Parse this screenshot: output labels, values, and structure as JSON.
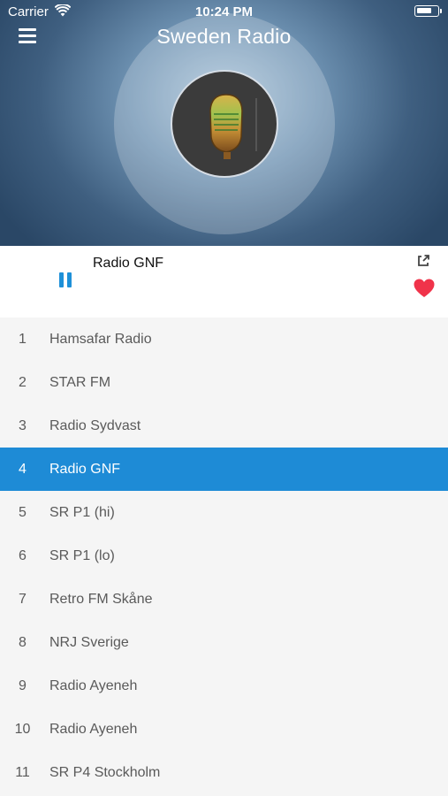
{
  "status_bar": {
    "carrier": "Carrier",
    "time": "10:24 PM"
  },
  "header": {
    "title": "Sweden Radio",
    "menu_icon": "hamburger-menu-icon"
  },
  "player": {
    "now_playing": "Radio GNF",
    "state_icon": "pause-icon",
    "share_icon": "external-link-icon",
    "favorite_icon": "heart-icon",
    "favorite_color": "#f0334a",
    "accent_color": "#1e8bd6"
  },
  "stations": [
    {
      "num": "1",
      "name": "Hamsafar Radio"
    },
    {
      "num": "2",
      "name": "STAR FM"
    },
    {
      "num": "3",
      "name": "Radio Sydvast"
    },
    {
      "num": "4",
      "name": "Radio GNF",
      "active": true
    },
    {
      "num": "5",
      "name": "SR P1 (hi)"
    },
    {
      "num": "6",
      "name": "SR P1 (lo)"
    },
    {
      "num": "7",
      "name": "Retro FM Skåne"
    },
    {
      "num": "8",
      "name": "NRJ Sverige"
    },
    {
      "num": "9",
      "name": "Radio Ayeneh"
    },
    {
      "num": "10",
      "name": "Radio Ayeneh"
    },
    {
      "num": "11",
      "name": "SR P4 Stockholm"
    }
  ]
}
